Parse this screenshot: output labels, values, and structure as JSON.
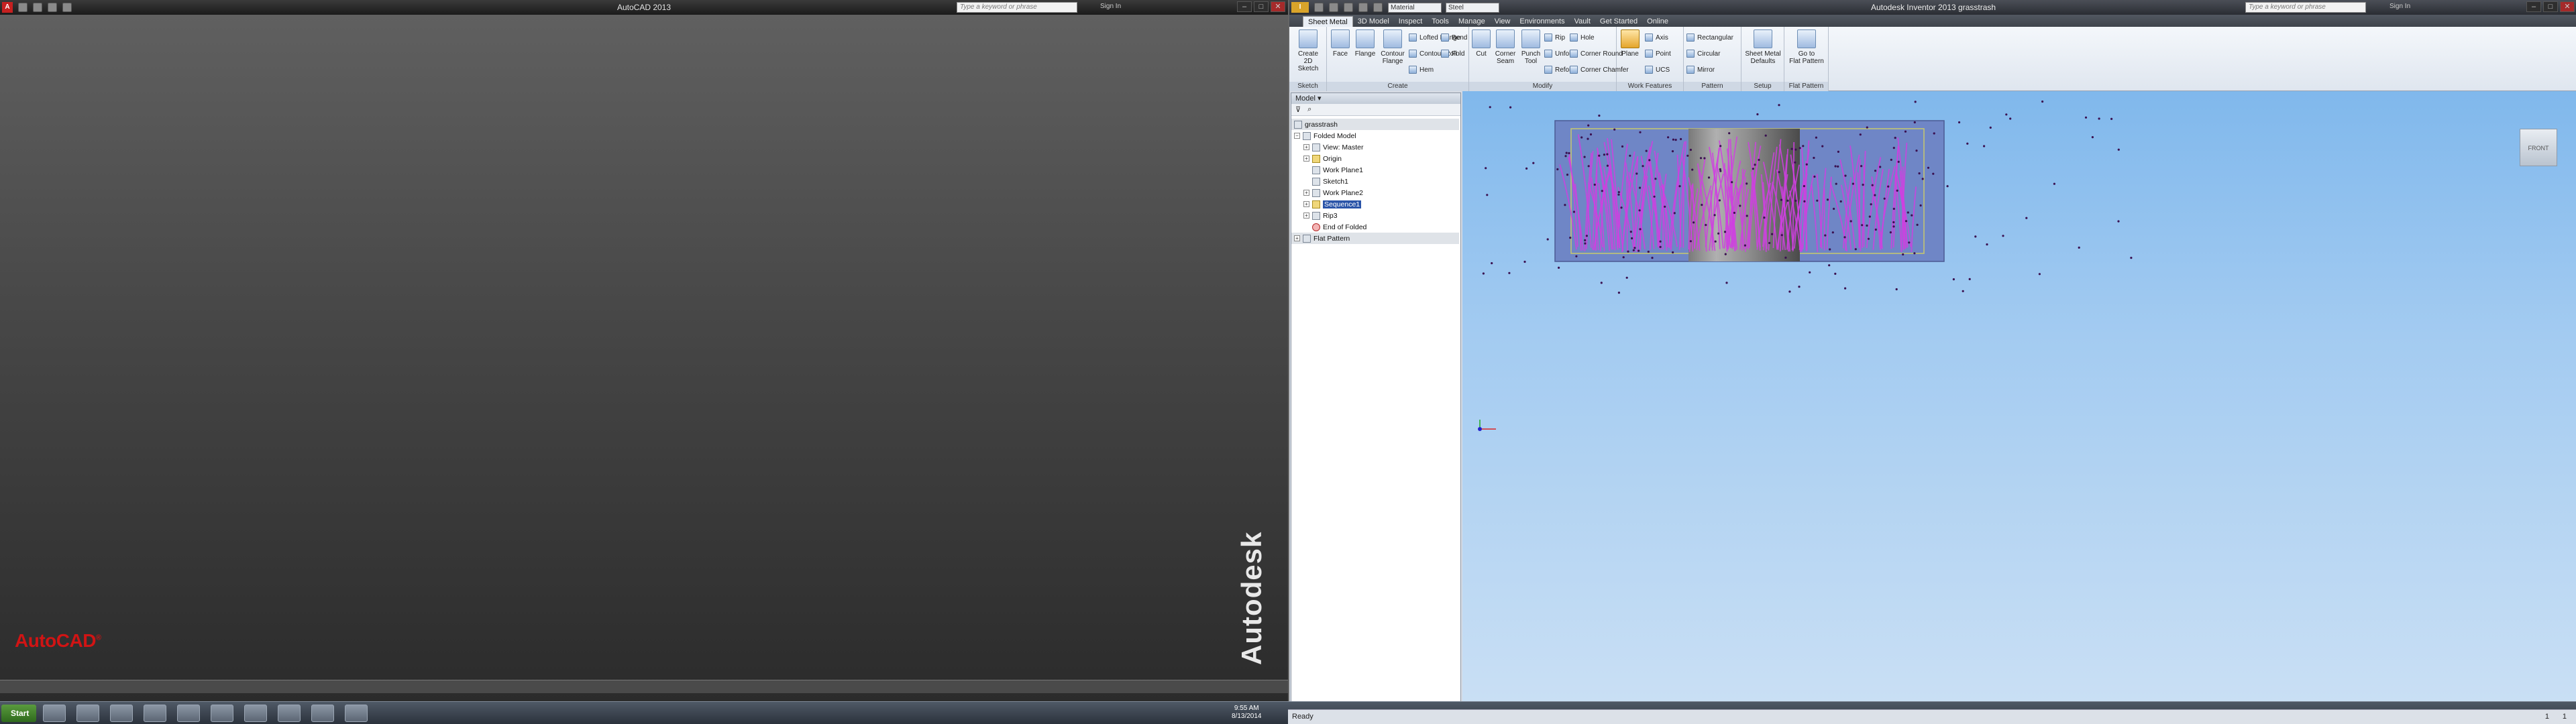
{
  "autocad": {
    "title": "AutoCAD 2013",
    "search_placeholder": "Type a keyword or phrase",
    "sign_in": "Sign In",
    "logo": "AutoCAD",
    "logo_mark": "®",
    "brand_vertical": "Autodesk"
  },
  "inventor": {
    "title": "Autodesk Inventor 2013   grasstrash",
    "appearance_combo": "Material",
    "material_combo": "Steel",
    "search_placeholder": "Type a keyword or phrase",
    "sign_in": "Sign In",
    "tabs": [
      "Sheet Metal",
      "3D Model",
      "Inspect",
      "Tools",
      "Manage",
      "View",
      "Environments",
      "Vault",
      "Get Started",
      "Online"
    ],
    "active_tab": "Sheet Metal",
    "ribbon": {
      "sketch": {
        "title": "Sketch",
        "create_2d_sketch": "Create\n2D Sketch"
      },
      "create": {
        "title": "Create",
        "face": "Face",
        "flange": "Flange",
        "contour_flange": "Contour\nFlange",
        "lofted_flange": "Lofted Flange",
        "contour_roll": "Contour Roll",
        "hem": "Hem",
        "bend": "Bend",
        "fold": "Fold"
      },
      "modify": {
        "title": "Modify",
        "cut": "Cut",
        "corner_seam": "Corner\nSeam",
        "punch_tool": "Punch\nTool",
        "rip": "Rip",
        "unfold": "Unfold",
        "refold": "Refold",
        "hole": "Hole",
        "corner_round": "Corner Round",
        "corner_chamfer": "Corner Chamfer"
      },
      "work_features": {
        "title": "Work Features",
        "plane": "Plane",
        "axis": "Axis",
        "point": "Point",
        "ucs": "UCS"
      },
      "pattern": {
        "title": "Pattern",
        "rectangular": "Rectangular",
        "circular": "Circular",
        "mirror": "Mirror"
      },
      "setup": {
        "title": "Setup",
        "sheet_metal_defaults": "Sheet Metal\nDefaults"
      },
      "flat_pattern": {
        "title": "Flat Pattern",
        "go_to_flat_pattern": "Go to\nFlat Pattern"
      }
    },
    "browser": {
      "header": "Model",
      "tree": [
        {
          "label": "grasstrash",
          "indent": 0
        },
        {
          "label": "Folded Model",
          "indent": 1
        },
        {
          "label": "View: Master",
          "indent": 2
        },
        {
          "label": "Origin",
          "indent": 2
        },
        {
          "label": "Work Plane1",
          "indent": 2
        },
        {
          "label": "Sketch1",
          "indent": 2
        },
        {
          "label": "Work Plane2",
          "indent": 2
        },
        {
          "label": "Sequence1",
          "indent": 2
        },
        {
          "label": "Rip3",
          "indent": 2
        },
        {
          "label": "End of Folded",
          "indent": 2
        },
        {
          "label": "Flat Pattern",
          "indent": 0
        }
      ]
    },
    "viewcube_label": "FRONT",
    "status": "Ready",
    "status_right": [
      "1",
      "1"
    ]
  },
  "taskbar": {
    "start": "Start",
    "time": "9:55 AM",
    "date": "8/13/2014"
  },
  "colors": {
    "autocad_red": "#d11414",
    "viewport_top": "#80b8ec",
    "sheet_fill": "#6f86c6",
    "strand": "#cf3fe0",
    "cylinder": "#8e8e8e"
  }
}
